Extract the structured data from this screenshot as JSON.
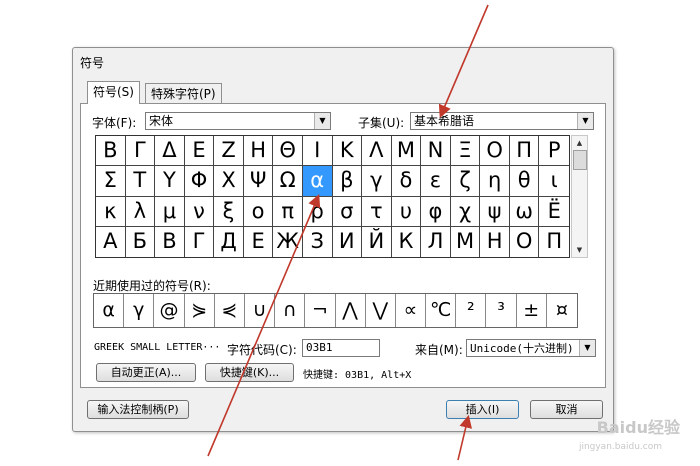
{
  "dialog": {
    "title": "符号"
  },
  "tabs": [
    {
      "label": "符号(S)"
    },
    {
      "label": "特殊字符(P)"
    }
  ],
  "font": {
    "label": "字体(F):",
    "value": "宋体"
  },
  "subset": {
    "label": "子集(U):",
    "value": "基本希腊语"
  },
  "symbols": [
    [
      "Β",
      "Γ",
      "Δ",
      "Ε",
      "Ζ",
      "Η",
      "Θ",
      "Ι",
      "Κ",
      "Λ",
      "Μ",
      "Ν",
      "Ξ",
      "Ο",
      "Π",
      "Ρ"
    ],
    [
      "Σ",
      "Τ",
      "Υ",
      "Φ",
      "Χ",
      "Ψ",
      "Ω",
      "α",
      "β",
      "γ",
      "δ",
      "ε",
      "ζ",
      "η",
      "θ",
      "ι"
    ],
    [
      "κ",
      "λ",
      "μ",
      "ν",
      "ξ",
      "ο",
      "π",
      "ρ",
      "σ",
      "τ",
      "υ",
      "φ",
      "χ",
      "ψ",
      "ω",
      "Ё"
    ],
    [
      "А",
      "Б",
      "В",
      "Г",
      "Д",
      "Е",
      "Ж",
      "З",
      "И",
      "Й",
      "К",
      "Л",
      "М",
      "Н",
      "О",
      "П"
    ]
  ],
  "selected": {
    "row": 1,
    "col": 7
  },
  "recent": {
    "label": "近期使用过的符号(R):",
    "symbols": [
      "α",
      "γ",
      "@",
      "⋟",
      "⋞",
      "∪",
      "∩",
      "¬",
      "⋀",
      "⋁",
      "∝",
      "℃",
      "²",
      "³",
      "±",
      "¤"
    ]
  },
  "char_name": "GREEK SMALL LETTER···",
  "char_code": {
    "label": "字符代码(C):",
    "value": "03B1"
  },
  "from": {
    "label": "来自(M):",
    "value": "Unicode(十六进制)"
  },
  "buttons": {
    "autocorrect": "自动更正(A)...",
    "shortcut_key": "快捷键(K)...",
    "ime": "输入法控制柄(P)",
    "insert": "插入(I)",
    "cancel": "取消"
  },
  "shortcut_text": "快捷键: 03B1, Alt+X",
  "watermark": {
    "brand": "Baidu经验",
    "url": "jingyan.baidu.com"
  },
  "colors": {
    "selection": "#3399ff",
    "annotation_arrow": "#c0392b"
  }
}
